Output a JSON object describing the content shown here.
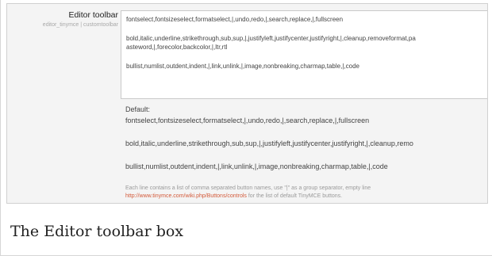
{
  "setting": {
    "label": "Editor toolbar",
    "identifier": "editor_tinymce | customtoolbar"
  },
  "textarea": {
    "lines": [
      "fontselect,fontsizeselect,formatselect,|,undo,redo,|,search,replace,|,fullscreen",
      "bold,italic,underline,strikethrough,sub,sup,|,justifyleft,justifycenter,justifyright,|,cleanup,removeformat,pa",
      "asteword,|,forecolor,backcolor,|,ltr,rtl",
      "bullist,numlist,outdent,indent,|,link,unlink,|,image,nonbreaking,charmap,table,|,code"
    ]
  },
  "default": {
    "heading": "Default:",
    "lines": [
      "fontselect,fontsizeselect,formatselect,|,undo,redo,|,search,replace,|,fullscreen",
      "bold,italic,underline,strikethrough,sub,sup,|,justifyleft,justifycenter,justifyright,|,cleanup,remo",
      "bullist,numlist,outdent,indent,|,link,unlink,|,image,nonbreaking,charmap,table,|,code"
    ]
  },
  "help": {
    "description": "Each line contains a list of comma separated button names, use \"|\" as a group separator, empty line",
    "link_text": "http://www.tinymce.com/wiki.php/Buttons/controls",
    "link_suffix": " for the list of default TinyMCE buttons."
  },
  "caption": "The Editor toolbar box",
  "colors": {
    "link": "#d35a3a",
    "muted_text": "#9a9a9a",
    "body_text": "#444444",
    "panel_background": "#f4f4f4"
  }
}
